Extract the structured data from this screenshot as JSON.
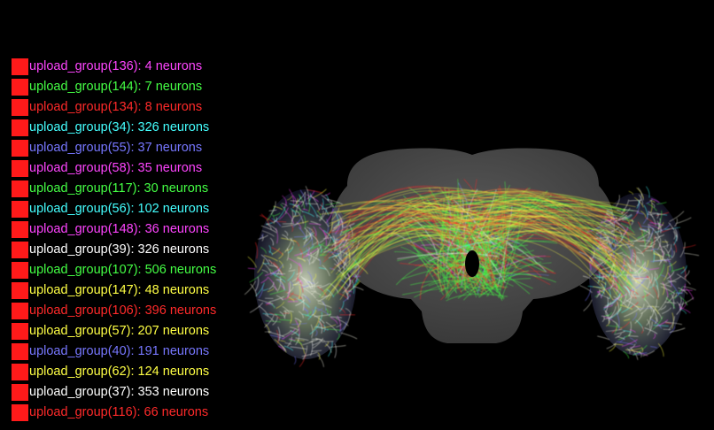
{
  "legend": {
    "items": [
      {
        "label": "upload_group(136): 4 neurons",
        "color": "#ff44ff",
        "swatch": "#ff1a1a"
      },
      {
        "label": "upload_group(144): 7 neurons",
        "color": "#44ff44",
        "swatch": "#ff1a1a"
      },
      {
        "label": "upload_group(134): 8 neurons",
        "color": "#ff2a2a",
        "swatch": "#ff1a1a"
      },
      {
        "label": "upload_group(34): 326 neurons",
        "color": "#44ffff",
        "swatch": "#ff1a1a"
      },
      {
        "label": "upload_group(55): 37 neurons",
        "color": "#7777ff",
        "swatch": "#ff1a1a"
      },
      {
        "label": "upload_group(58): 35 neurons",
        "color": "#ff44ff",
        "swatch": "#ff1a1a"
      },
      {
        "label": "upload_group(117): 30 neurons",
        "color": "#44ff44",
        "swatch": "#ff1a1a"
      },
      {
        "label": "upload_group(56): 102 neurons",
        "color": "#44ffff",
        "swatch": "#ff1a1a"
      },
      {
        "label": "upload_group(148): 36 neurons",
        "color": "#ff44ff",
        "swatch": "#ff1a1a"
      },
      {
        "label": "upload_group(39): 326 neurons",
        "color": "#ffffff",
        "swatch": "#ff1a1a"
      },
      {
        "label": "upload_group(107): 506 neurons",
        "color": "#44ff44",
        "swatch": "#ff1a1a"
      },
      {
        "label": "upload_group(147): 48 neurons",
        "color": "#ffff44",
        "swatch": "#ff1a1a"
      },
      {
        "label": "upload_group(106): 396 neurons",
        "color": "#ff2a2a",
        "swatch": "#ff1a1a"
      },
      {
        "label": "upload_group(57): 207 neurons",
        "color": "#ffff44",
        "swatch": "#ff1a1a"
      },
      {
        "label": "upload_group(40): 191 neurons",
        "color": "#7777ff",
        "swatch": "#ff1a1a"
      },
      {
        "label": "upload_group(62): 124 neurons",
        "color": "#ffff44",
        "swatch": "#ff1a1a"
      },
      {
        "label": "upload_group(37): 353 neurons",
        "color": "#ffffff",
        "swatch": "#ff1a1a"
      },
      {
        "label": "upload_group(116): 66 neurons",
        "color": "#ff2a2a",
        "swatch": "#ff1a1a"
      }
    ]
  },
  "viewer": {
    "background": "#000000",
    "brain_mesh_color": "#4a4a4a",
    "neuron_colors": [
      "#ff44ff",
      "#44ff44",
      "#ff2a2a",
      "#44ffff",
      "#7777ff",
      "#ffffff",
      "#ffff44"
    ]
  }
}
